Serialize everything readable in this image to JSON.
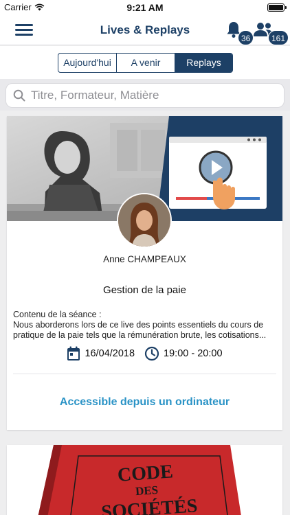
{
  "status_bar": {
    "carrier": "Carrier",
    "time": "9:21 AM"
  },
  "nav": {
    "title": "Lives & Replays",
    "notifications_count": "36",
    "participants_count": "161"
  },
  "segments": [
    {
      "label": "Aujourd'hui",
      "active": false
    },
    {
      "label": "A venir",
      "active": false
    },
    {
      "label": "Replays",
      "active": true
    }
  ],
  "search": {
    "placeholder": "Titre, Formateur, Matière",
    "value": ""
  },
  "sessions": [
    {
      "trainer": "Anne CHAMPEAUX",
      "title": "Gestion de la paie",
      "description_label": "Contenu de la séance :",
      "description": "Nous aborderons lors de ce live des points essentiels du cours de pratique de la paie tels que la rémunération brute, les cotisations...",
      "date": "16/04/2018",
      "time": "19:00 - 20:00",
      "action": "Accessible depuis un ordinateur"
    },
    {
      "cover_text": [
        "CODE",
        "DES",
        "SOCIÉTÉS"
      ]
    }
  ],
  "colors": {
    "primary": "#1d4066",
    "link": "#2a93c6",
    "background": "#eeeeef"
  },
  "icons": [
    "menu-icon",
    "bell-icon",
    "people-icon",
    "search-icon",
    "calendar-icon",
    "clock-icon",
    "wifi-icon",
    "battery-icon"
  ]
}
